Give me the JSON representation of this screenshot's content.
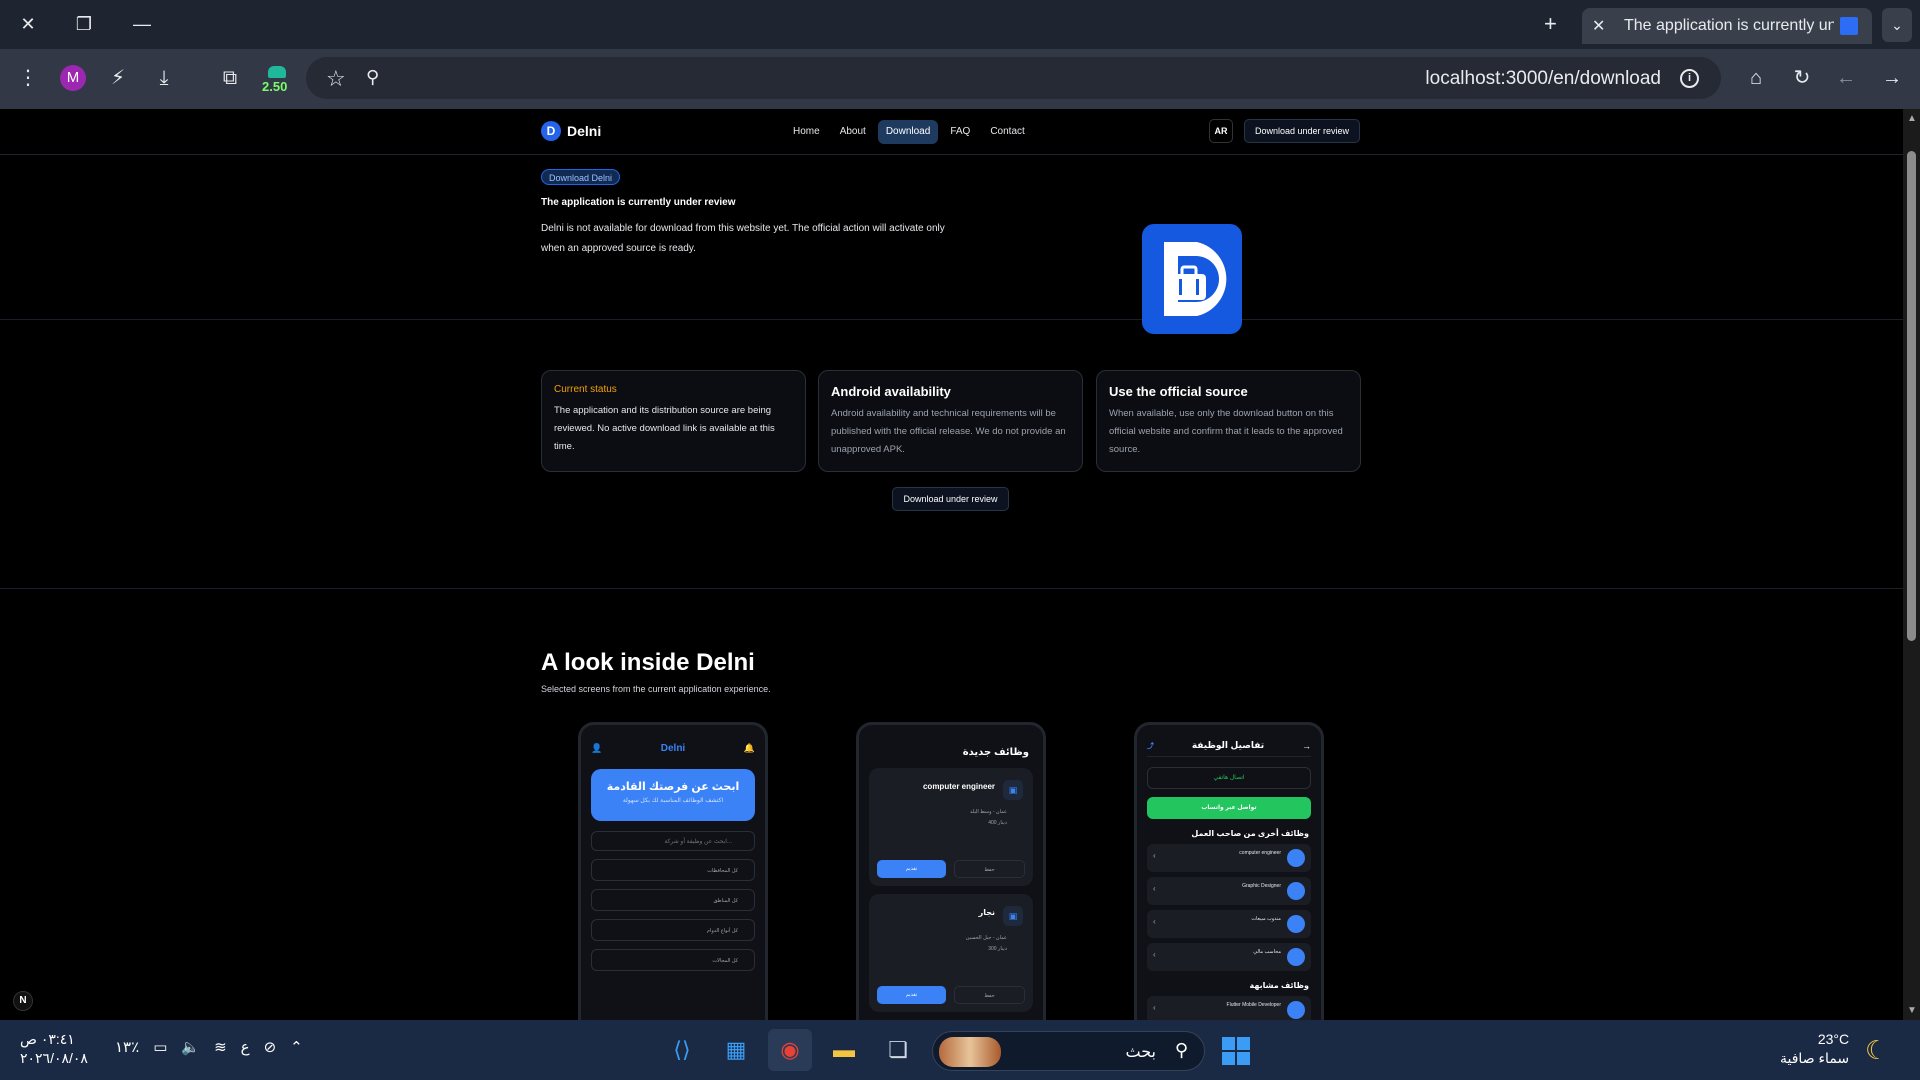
{
  "browser": {
    "tab_title": "The application is currently und",
    "url": "localhost:3000/en/download",
    "profile_initial": "M",
    "extension_badge": "2.50",
    "accent": "#2d6df6"
  },
  "site": {
    "brand": "Delni",
    "logo_letter": "D",
    "nav": [
      "Home",
      "About",
      "Download",
      "FAQ",
      "Contact"
    ],
    "active_nav": "Download",
    "lang_button": "AR",
    "header_download": "Download under review"
  },
  "hero": {
    "pill": "Download Delni",
    "title": "The application is currently under review",
    "description": "Delni is not available for download from this website yet. The official action will activate only when an approved source is ready."
  },
  "cards": [
    {
      "title": "Current status",
      "desc": "The application and its distribution source are being reviewed. No active download link is available at this time."
    },
    {
      "title": "Android availability",
      "desc": "Android availability and technical requirements will be published with the official release. We do not provide an unapproved APK."
    },
    {
      "title": "Use the official source",
      "desc": "When available, use only the download button on this official website and confirm that it leads to the approved source."
    }
  ],
  "center_button": "Download under review",
  "look": {
    "title": "A look inside Delni",
    "subtitle": "Selected screens from the current application experience."
  },
  "phone1": {
    "brand": "Delni",
    "hero_title": "ابحث عن فرصتك القادمة",
    "hero_sub": "اكتشف الوظائف المناسبة لك بكل سهولة",
    "search_placeholder": "ابحث عن وظيفة أو شركة...",
    "filters": [
      "كل المحافظات",
      "كل المناطق",
      "كل أنواع الدوام",
      "كل المجالات"
    ]
  },
  "phone2": {
    "section": "وظائف جديدة",
    "jobs": [
      {
        "title": "computer engineer",
        "meta1": "عمان - وسط البلد",
        "meta2": "400 دينار",
        "apply": "تقديم",
        "save": "حفظ"
      },
      {
        "title": "نجار",
        "meta1": "عمان - جبل الحسين",
        "meta2": "300 دينار",
        "apply": "تقديم",
        "save": "حفظ"
      }
    ]
  },
  "phone3": {
    "title": "تفاصيل الوظيفة",
    "call": "اتصال هاتفي",
    "whatsapp": "تواصل عبر واتساب",
    "employer_section": "وظائف أخرى من صاحب العمل",
    "employer_jobs": [
      "computer engineer",
      "Graphic Designer",
      "مندوب مبيعات",
      "محاسب مالي"
    ],
    "similar_section": "وظائف مشابهة",
    "similar_jobs": [
      "Flutter Mobile Developer"
    ]
  },
  "taskbar": {
    "time": "٠٣:٤١ ص",
    "date": "٢٠٢٦/٠٨/٠٨",
    "battery": "١٣٪",
    "lang": "ع",
    "search": "بحث",
    "temp": "23°C",
    "weather": "سماء صافية"
  }
}
